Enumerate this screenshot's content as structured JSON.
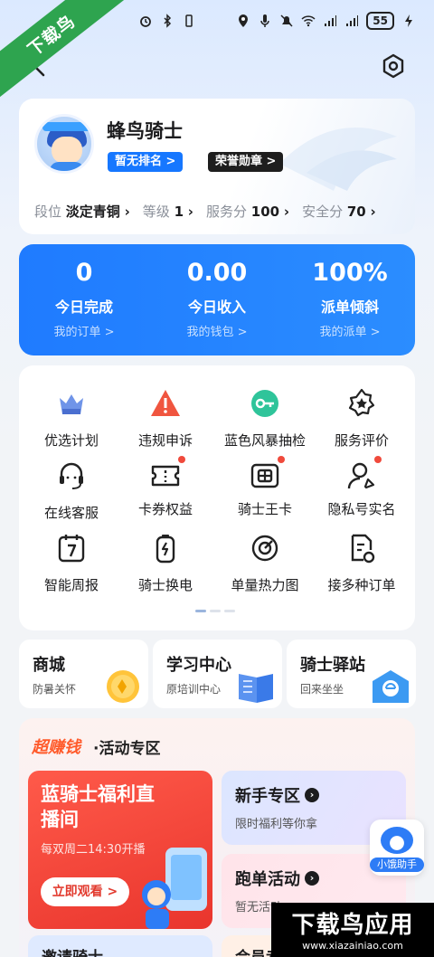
{
  "watermark": {
    "ribbon": "下载鸟",
    "bottom_main": "下载鸟应用",
    "bottom_url": "www.xiazainiao.com"
  },
  "status_bar": {
    "battery": "55",
    "icons": [
      "alarm-icon",
      "bluetooth-icon",
      "vibrate-icon",
      "location-icon",
      "mic-icon",
      "mute-icon",
      "wifi-icon",
      "signal-4g-icon",
      "signal-4g-icon",
      "charging-icon"
    ]
  },
  "profile": {
    "name": "蜂鸟骑士",
    "rank_tag": "暂无排名 >",
    "honor_tag": "荣誉勋章 >",
    "stats": [
      {
        "label": "段位",
        "value": "淡定青铜"
      },
      {
        "label": "等级",
        "value": "1"
      },
      {
        "label": "服务分",
        "value": "100"
      },
      {
        "label": "安全分",
        "value": "70"
      }
    ]
  },
  "summary": [
    {
      "value": "0",
      "label": "今日完成",
      "link": "我的订单 >"
    },
    {
      "value": "0.00",
      "label": "今日收入",
      "link": "我的钱包 >"
    },
    {
      "value": "100%",
      "label": "派单倾斜",
      "link": "我的派单 >"
    }
  ],
  "services": [
    {
      "label": "优选计划",
      "icon": "crown-icon"
    },
    {
      "label": "违规申诉",
      "icon": "warning-icon"
    },
    {
      "label": "蓝色风暴抽检",
      "icon": "storm-check-icon"
    },
    {
      "label": "服务评价",
      "icon": "star-badge-icon"
    },
    {
      "label": "在线客服",
      "icon": "headset-icon"
    },
    {
      "label": "卡券权益",
      "icon": "coupon-icon"
    },
    {
      "label": "骑士王卡",
      "icon": "sim-card-icon"
    },
    {
      "label": "隐私号实名",
      "icon": "user-verify-icon"
    },
    {
      "label": "智能周报",
      "icon": "calendar-7-icon"
    },
    {
      "label": "骑士换电",
      "icon": "battery-swap-icon"
    },
    {
      "label": "单量热力图",
      "icon": "heatmap-icon"
    },
    {
      "label": "接多种订单",
      "icon": "multi-order-icon"
    }
  ],
  "tiles": [
    {
      "title": "商城",
      "subtitle": "防暑关怀"
    },
    {
      "title": "学习中心",
      "subtitle": "原培训中心"
    },
    {
      "title": "骑士驿站",
      "subtitle": "回来坐坐"
    }
  ],
  "activity": {
    "title_brand": "超赚钱",
    "title": "·活动专区",
    "big_card": {
      "title": "蓝骑士福利直播间",
      "subtitle": "每双周二14:30开播",
      "button": "立即观看 >"
    },
    "cards": [
      {
        "title": "新手专区",
        "subtitle": "限时福利等你拿"
      },
      {
        "title": "跑单活动",
        "subtitle": "暂无活动"
      }
    ],
    "peek": [
      "邀请骑士",
      "会员专享"
    ]
  },
  "assistant": {
    "label": "小饿助手"
  },
  "colors": {
    "primary": "#1f7bff",
    "red": "#e9352d",
    "brand_orange": "#ff5a2a"
  }
}
